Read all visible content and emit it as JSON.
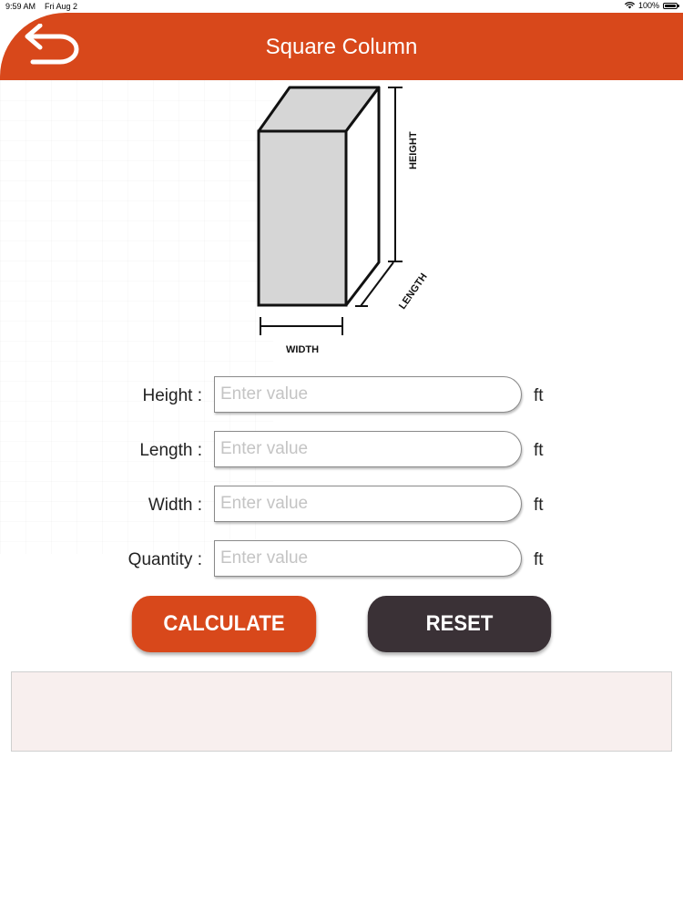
{
  "status_bar": {
    "time": "9:59 AM",
    "date": "Fri Aug 2",
    "battery": "100%"
  },
  "header": {
    "title": "Square Column",
    "back_icon": "back-arrow-icon"
  },
  "diagram": {
    "height_label": "HEIGHT",
    "length_label": "LENGTH",
    "width_label": "WIDTH"
  },
  "form": {
    "fields": [
      {
        "label": "Height :",
        "placeholder": "Enter value",
        "value": "",
        "unit": "ft"
      },
      {
        "label": "Length :",
        "placeholder": "Enter value",
        "value": "",
        "unit": "ft"
      },
      {
        "label": "Width :",
        "placeholder": "Enter value",
        "value": "",
        "unit": "ft"
      },
      {
        "label": "Quantity :",
        "placeholder": "Enter value",
        "value": "",
        "unit": "ft"
      }
    ]
  },
  "buttons": {
    "calculate": "CALCULATE",
    "reset": "RESET"
  },
  "colors": {
    "accent": "#d8481b",
    "dark_button": "#3a3136",
    "result_bg": "#f8efee"
  }
}
